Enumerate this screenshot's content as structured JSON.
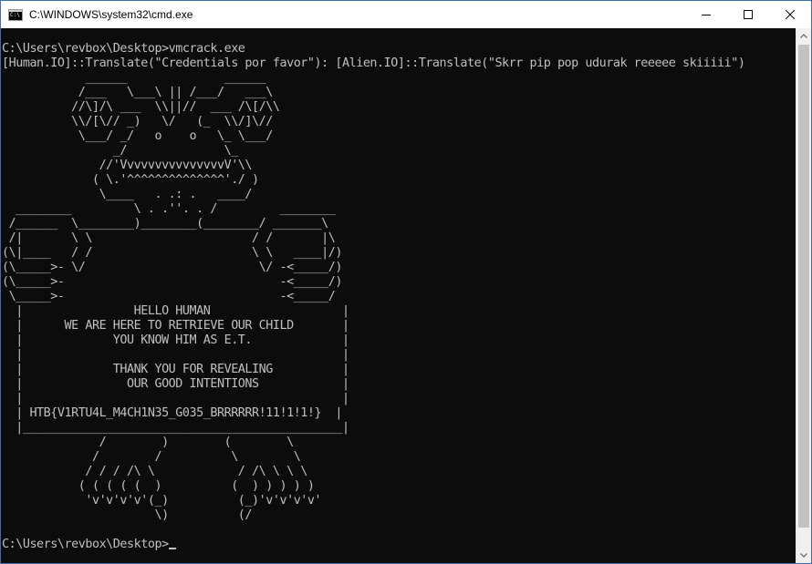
{
  "window": {
    "title": "C:\\WINDOWS\\system32\\cmd.exe",
    "icon": "cmd-icon",
    "controls": [
      "minimize-icon",
      "maximize-icon",
      "close-icon"
    ]
  },
  "colors": {
    "console_bg": "#0c0c0c",
    "console_text": "#c0c0c0",
    "titlebar_bg": "#ffffff",
    "scrollbar_track": "#f0f0f0",
    "scrollbar_thumb": "#c2c2c2"
  },
  "console": {
    "lines": [
      "C:\\Users\\revbox\\Desktop>vmcrack.exe",
      "[Human.IO]::Translate(\"Credentials por favor\"): [Alien.IO]::Translate(\"Skrr pip pop udurak reeeee skiiiii\")",
      "            ______              ______",
      "           /___   \\___\\ || /___/   ___\\",
      "          //\\]/\\ ___  \\\\||//  ___ /\\[/\\\\",
      "          \\\\/[\\// _)   \\/   (_  \\\\/]\\//",
      "           \\___/ _/   o    o   \\_ \\___/",
      "                _/              \\_",
      "              //'VvvvvvvvvvvvvvvV'\\\\",
      "             ( \\.'^^^^^^^^^^^^^^'./ )",
      "              \\____   . .: .   ____/",
      "  ________         \\ . .''. . /         ________",
      " /______  \\________)________(________/ _______\\",
      " /|       \\ \\                       / /       |\\",
      "(\\|____   / /                       \\ \\   ____|/)",
      "(\\_____>- \\/                         \\/ -<_____/)",
      "(\\_____>-                               -<_____/)",
      " \\_____>-                               -<_____/",
      "  |                HELLO HUMAN                   |",
      "  |      WE ARE HERE TO RETRIEVE OUR CHILD       |",
      "  |             YOU KNOW HIM AS E.T.             |",
      "  |                                              |",
      "  |             THANK YOU FOR REVEALING          |",
      "  |               OUR GOOD INTENTIONS            |",
      "  |                                              |",
      "  | HTB{V1RTU4L_M4CH1N35_G035_BRRRRRR!11!1!1!}  |",
      "  |______________________________________________|",
      "              /        )        (        \\",
      "             /        /          \\        \\",
      "            / / / /\\ \\            / /\\ \\ \\ \\",
      "           ( ( ( ( (  )          (  ) ) ) ) )",
      "            'v'v'v'v'(_)          (_)'v'v'v'v'",
      "                      \\)          (/",
      "",
      "C:\\Users\\revbox\\Desktop>"
    ]
  },
  "scrollbar": {
    "up_icon": "scroll-up-arrow-icon",
    "down_icon": "scroll-down-arrow-icon"
  }
}
